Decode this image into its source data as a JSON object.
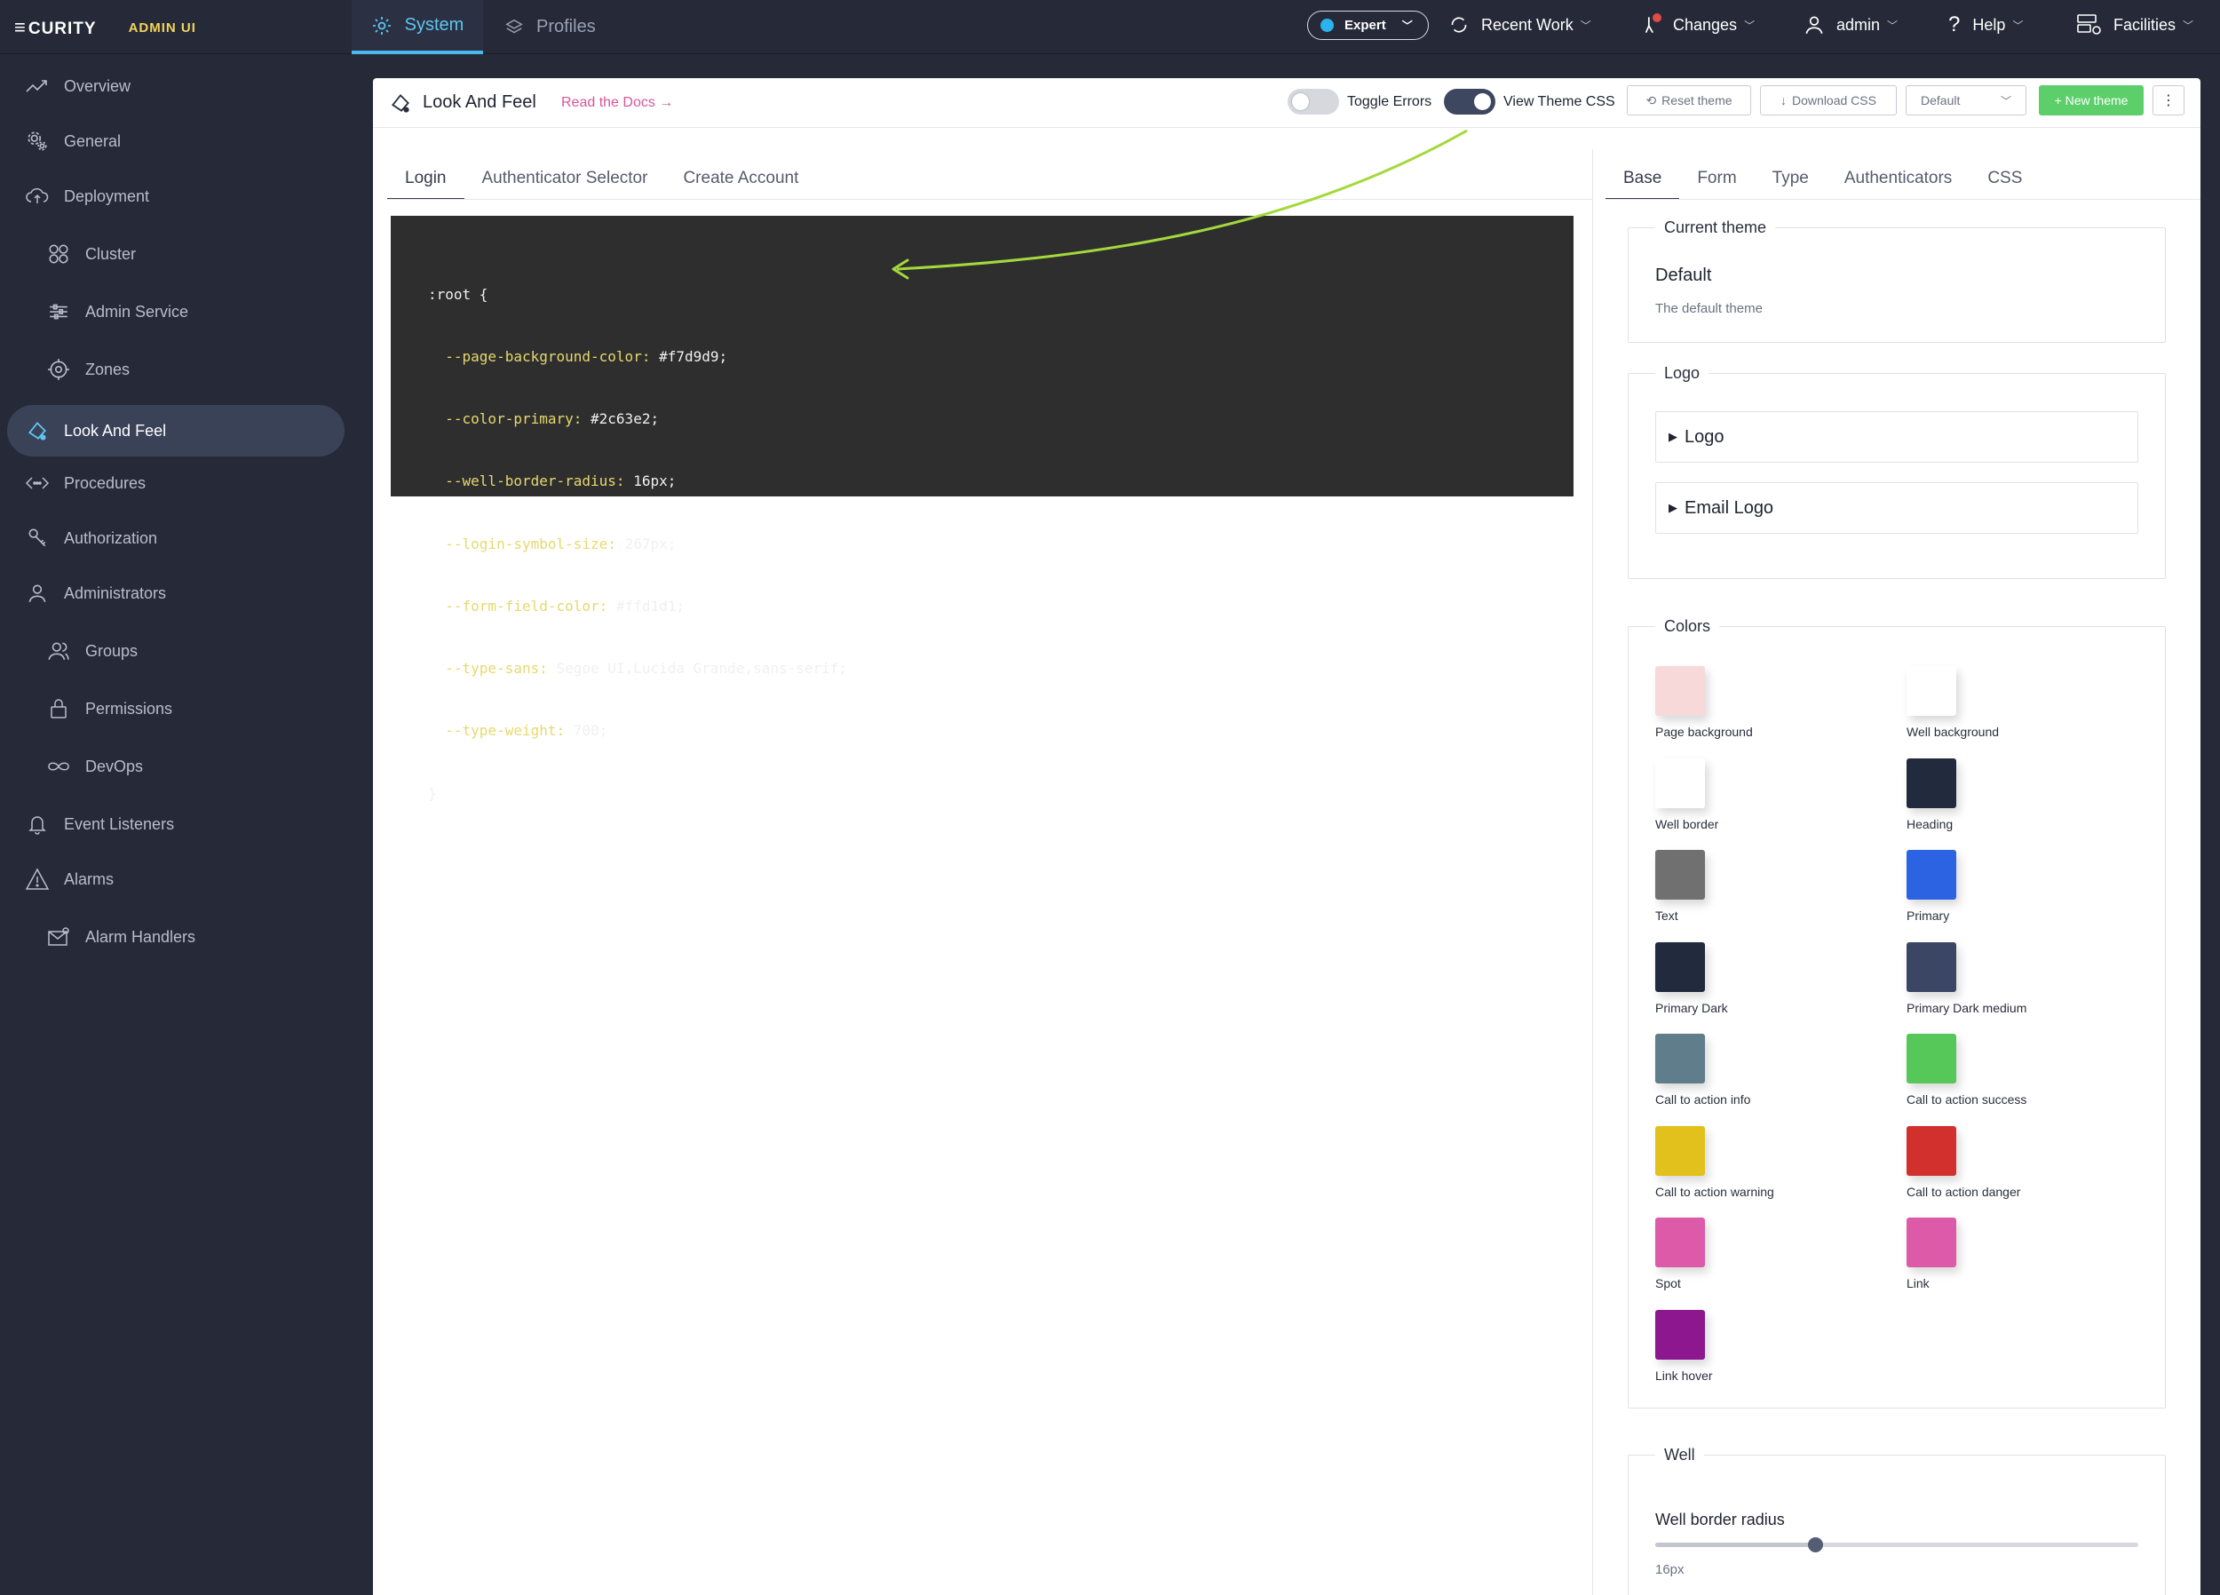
{
  "topbar": {
    "brand": "CURITY",
    "brand_sub": "ADMIN UI",
    "tabs": [
      {
        "label": "System",
        "icon": "gear-icon",
        "active": true
      },
      {
        "label": "Profiles",
        "icon": "layers-icon",
        "active": false
      }
    ],
    "expert_label": "Expert",
    "recent_work": "Recent Work",
    "changes": "Changes",
    "user": "admin",
    "help": "Help",
    "facilities": "Facilities"
  },
  "sidebar": {
    "items": [
      {
        "label": "Overview",
        "icon": "trend-icon",
        "level": 1
      },
      {
        "label": "General",
        "icon": "gears-icon",
        "level": 1
      },
      {
        "label": "Deployment",
        "icon": "cloud-upload-icon",
        "level": 1
      },
      {
        "label": "Cluster",
        "icon": "cluster-icon",
        "level": 2
      },
      {
        "label": "Admin Service",
        "icon": "sliders-icon",
        "level": 2
      },
      {
        "label": "Zones",
        "icon": "target-icon",
        "level": 2
      },
      {
        "label": "Look And Feel",
        "icon": "palette-icon",
        "level": 1,
        "active": true
      },
      {
        "label": "Procedures",
        "icon": "code-icon",
        "level": 1
      },
      {
        "label": "Authorization",
        "icon": "key-icon",
        "level": 1
      },
      {
        "label": "Administrators",
        "icon": "user-icon",
        "level": 1
      },
      {
        "label": "Groups",
        "icon": "users-icon",
        "level": 2
      },
      {
        "label": "Permissions",
        "icon": "lock-icon",
        "level": 2
      },
      {
        "label": "DevOps",
        "icon": "infinity-icon",
        "level": 2
      },
      {
        "label": "Event Listeners",
        "icon": "bell-icon",
        "level": 1
      },
      {
        "label": "Alarms",
        "icon": "warning-icon",
        "level": 1
      },
      {
        "label": "Alarm Handlers",
        "icon": "mail-icon",
        "level": 2
      }
    ]
  },
  "main": {
    "title": "Look And Feel",
    "docs_link": "Read the Docs →",
    "toggle_errors": {
      "label": "Toggle Errors",
      "on": false
    },
    "view_theme_css": {
      "label": "View Theme CSS",
      "on": true
    },
    "reset_theme": "Reset theme",
    "download_css": "Download CSS",
    "theme_select": "Default",
    "new_theme": "+ New theme",
    "more": "⋮",
    "left_tabs": [
      "Login",
      "Authenticator Selector",
      "Create Account"
    ],
    "css_code": {
      "open": ":root {",
      "lines": [
        {
          "prop": "--page-background-color:",
          "value": " #f7d9d9;"
        },
        {
          "prop": "--color-primary:",
          "value": " #2c63e2;"
        },
        {
          "prop": "--well-border-radius:",
          "value": " 16px;"
        },
        {
          "prop": "--login-symbol-size:",
          "value": " 267px;"
        },
        {
          "prop": "--form-field-color:",
          "value": " #ffd1d1;"
        },
        {
          "prop": "--type-sans:",
          "value": " Segoe UI,Lucida Grande,sans-serif;"
        },
        {
          "prop": "--type-weight:",
          "value": " 700;"
        }
      ],
      "close": "}"
    },
    "right_tabs": [
      "Base",
      "Form",
      "Type",
      "Authenticators",
      "CSS"
    ],
    "current_theme": {
      "legend": "Current theme",
      "name": "Default",
      "description": "The default theme"
    },
    "logo": {
      "legend": "Logo",
      "items": [
        "Logo",
        "Email Logo"
      ]
    },
    "colors": {
      "legend": "Colors",
      "swatches": [
        {
          "label": "Page background",
          "color": "#f7d9d9"
        },
        {
          "label": "Well background",
          "color": "#ffffff"
        },
        {
          "label": "Well border",
          "color": "#ffffff"
        },
        {
          "label": "Heading",
          "color": "#222a3d"
        },
        {
          "label": "Text",
          "color": "#707070"
        },
        {
          "label": "Primary",
          "color": "#2c63e2"
        },
        {
          "label": "Primary Dark",
          "color": "#222a3d"
        },
        {
          "label": "Primary Dark medium",
          "color": "#3a4664"
        },
        {
          "label": "Call to action info",
          "color": "#607d8b"
        },
        {
          "label": "Call to action success",
          "color": "#56c85a"
        },
        {
          "label": "Call to action warning",
          "color": "#e2c11c"
        },
        {
          "label": "Call to action danger",
          "color": "#d2302d"
        },
        {
          "label": "Spot",
          "color": "#dd5aa8"
        },
        {
          "label": "Link",
          "color": "#dd5aa8"
        },
        {
          "label": "Link hover",
          "color": "#8c178f"
        }
      ]
    },
    "well": {
      "legend": "Well",
      "border_radius_label": "Well border radius",
      "border_radius_value": "16px",
      "slider_fraction": 0.33
    }
  },
  "colors": {
    "accent": "#49b9ef",
    "annotation_arrow": "#a3d93c"
  }
}
